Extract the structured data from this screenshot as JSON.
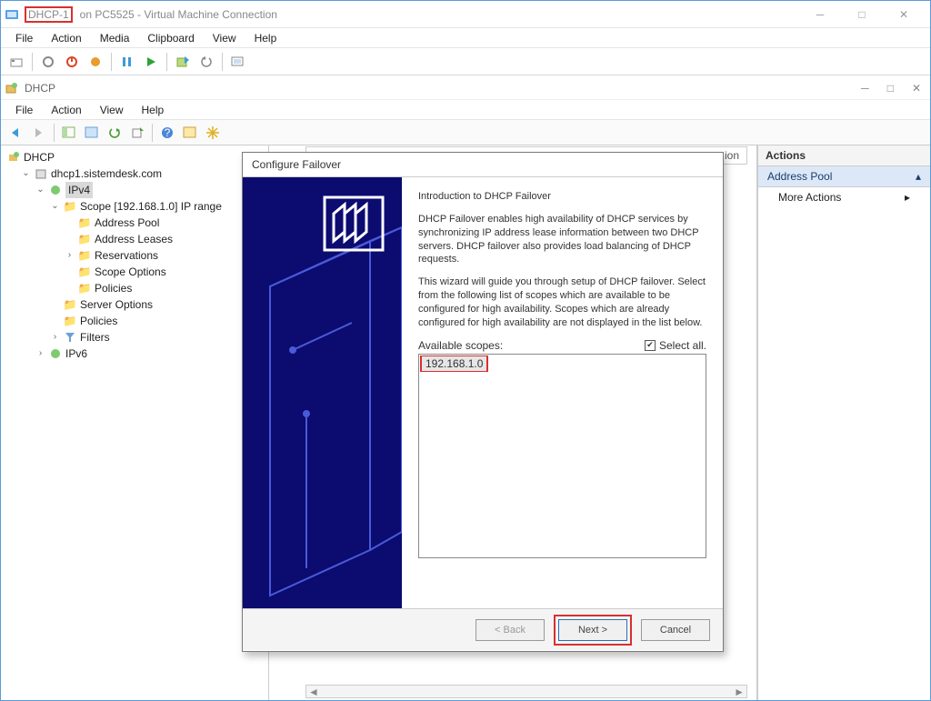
{
  "vm": {
    "title_short": "DHCP-1",
    "title_rest": "on PC5525 - Virtual Machine Connection",
    "menu": [
      "File",
      "Action",
      "Media",
      "Clipboard",
      "View",
      "Help"
    ]
  },
  "inner": {
    "title": "DHCP",
    "menu": [
      "File",
      "Action",
      "View",
      "Help"
    ]
  },
  "tree": {
    "root": "DHCP",
    "server": "dhcp1.sistemdesk.com",
    "ipv4": "IPv4",
    "scope": "Scope [192.168.1.0] IP range",
    "nodes": {
      "address_pool": "Address Pool",
      "address_leases": "Address Leases",
      "reservations": "Reservations",
      "scope_options": "Scope Options",
      "policies": "Policies",
      "server_options": "Server Options",
      "policies2": "Policies",
      "filters": "Filters",
      "ipv6": "IPv6"
    }
  },
  "center_header": {
    "col_desc": "ion"
  },
  "actions": {
    "title": "Actions",
    "subject": "Address Pool",
    "more": "More Actions"
  },
  "wizard": {
    "title": "Configure Failover",
    "heading": "Introduction to DHCP Failover",
    "para1": "DHCP Failover enables high availability of DHCP services by synchronizing IP address lease information between two DHCP servers. DHCP failover also provides load balancing of DHCP requests.",
    "para2": "This wizard will guide you through setup of DHCP failover. Select from the following list of scopes which are available to be configured for high availability. Scopes which are already configured for high availability are not displayed in the list below.",
    "available_label": "Available scopes:",
    "select_all": "Select all.",
    "scopes": [
      "192.168.1.0"
    ],
    "back": "< Back",
    "next": "Next >",
    "cancel": "Cancel"
  },
  "axis_ticks": ""
}
